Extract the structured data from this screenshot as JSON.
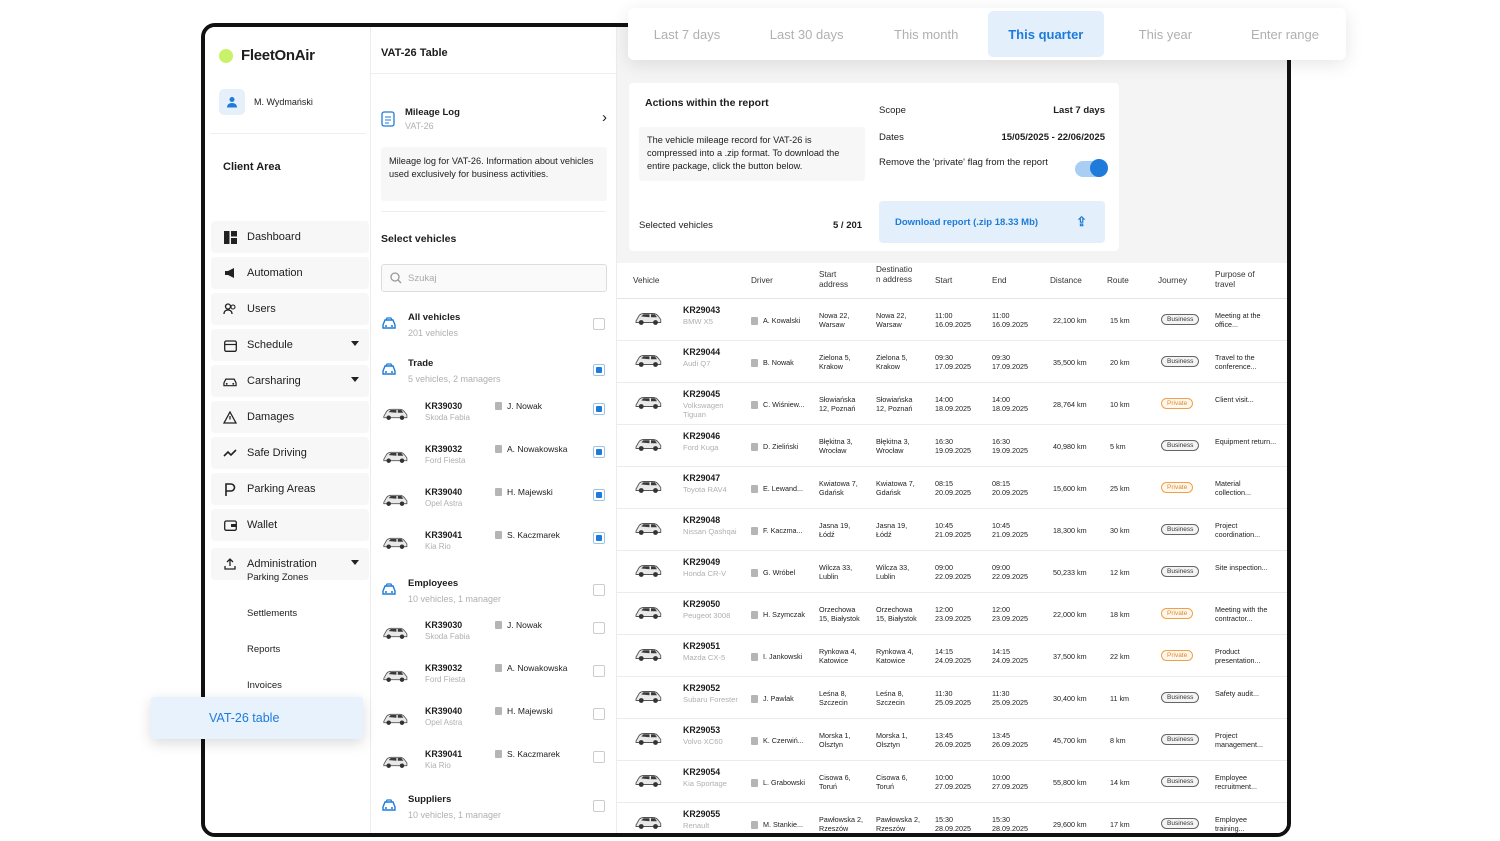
{
  "app": {
    "name": "FleetOnAir",
    "user": "M. Wydmański",
    "client_area": "Client Area"
  },
  "nav": [
    {
      "label": "Dashboard",
      "icon": "dashboard-icon"
    },
    {
      "label": "Automation",
      "icon": "megaphone-icon"
    },
    {
      "label": "Users",
      "icon": "users-icon"
    },
    {
      "label": "Schedule",
      "icon": "calendar-icon",
      "expandable": true
    },
    {
      "label": "Carsharing",
      "icon": "car-icon",
      "expandable": true
    },
    {
      "label": "Damages",
      "icon": "warning-icon"
    },
    {
      "label": "Safe Driving",
      "icon": "trend-icon"
    },
    {
      "label": "Parking Areas",
      "icon": "parking-icon"
    },
    {
      "label": "Wallet",
      "icon": "wallet-icon"
    },
    {
      "label": "Administration",
      "icon": "upload-icon",
      "expandable": true
    }
  ],
  "admin_sub": [
    "Parking Zones",
    "Settlements",
    "Reports",
    "Invoices"
  ],
  "active_item": "VAT-26 table",
  "panel": {
    "title": "VAT-26 Table",
    "mileage_title": "Mileage Log",
    "mileage_sub": "VAT-26",
    "description": "Mileage log for VAT-26. Information about vehicles used exclusively for business activities.",
    "select_title": "Select vehicles",
    "search_placeholder": "Szukaj",
    "all": {
      "title": "All vehicles",
      "sub": "201 vehicles"
    },
    "groups": [
      {
        "title": "Trade",
        "sub": "5 vehicles, 2 managers",
        "checked": true,
        "vehicles": [
          {
            "plate": "KR39030",
            "model": "Skoda Fabia",
            "driver": "J. Nowak",
            "checked": true
          },
          {
            "plate": "KR39032",
            "model": "Ford Fiesta",
            "driver": "A. Nowakowska",
            "checked": true
          },
          {
            "plate": "KR39040",
            "model": "Opel Astra",
            "driver": "H. Majewski",
            "checked": true
          },
          {
            "plate": "KR39041",
            "model": "Kia Rio",
            "driver": "S. Kaczmarek",
            "checked": true
          }
        ]
      },
      {
        "title": "Employees",
        "sub": "10 vehicles, 1 manager",
        "checked": false,
        "vehicles": [
          {
            "plate": "KR39030",
            "model": "Skoda Fabia",
            "driver": "J. Nowak",
            "checked": false
          },
          {
            "plate": "KR39032",
            "model": "Ford Fiesta",
            "driver": "A. Nowakowska",
            "checked": false
          },
          {
            "plate": "KR39040",
            "model": "Opel Astra",
            "driver": "H. Majewski",
            "checked": false
          },
          {
            "plate": "KR39041",
            "model": "Kia Rio",
            "driver": "S. Kaczmarek",
            "checked": false
          }
        ]
      },
      {
        "title": "Suppliers",
        "sub": "10 vehicles, 1 manager",
        "checked": false,
        "vehicles": []
      }
    ]
  },
  "ranges": [
    "Last 7 days",
    "Last 30 days",
    "This month",
    "This quarter",
    "This year",
    "Enter range"
  ],
  "active_range": "This quarter",
  "actions": {
    "title": "Actions within the report",
    "info": "The vehicle mileage record for VAT-26 is compressed into a .zip format. To download the entire package, click the button below.",
    "selected_label": "Selected vehicles",
    "selected_value": "5 / 201",
    "scope_label": "Scope",
    "scope_value": "Last 7 days",
    "dates_label": "Dates",
    "dates_value": "15/05/2025 - 22/06/2025",
    "private_label": "Remove the 'private' flag from the report",
    "private_on": true,
    "download": "Download report (.zip 18.33 Mb)"
  },
  "table": {
    "headers": [
      "Vehicle",
      "Driver",
      "Start address",
      "Destination address",
      "Start",
      "End",
      "Distance",
      "Route",
      "Journey",
      "Purpose of travel"
    ],
    "rows": [
      {
        "plate": "KR29043",
        "model": "BMW X5",
        "driver": "A. Kowalski",
        "start_addr": "Nowa 22, Warsaw",
        "dest_addr": "Nowa 22, Warsaw",
        "start_t": "11:00",
        "start_d": "16.09.2025",
        "end_t": "11:00",
        "end_d": "16.09.2025",
        "distance": "22,100 km",
        "route": "15 km",
        "journey": "Business",
        "purpose": "Meeting at the office..."
      },
      {
        "plate": "KR29044",
        "model": "Audi Q7",
        "driver": "B. Nowak",
        "start_addr": "Zielona 5, Krakow",
        "dest_addr": "Zielona 5, Krakow",
        "start_t": "09:30",
        "start_d": "17.09.2025",
        "end_t": "09:30",
        "end_d": "17.09.2025",
        "distance": "35,500 km",
        "route": "20 km",
        "journey": "Business",
        "purpose": "Travel to the conference..."
      },
      {
        "plate": "KR29045",
        "model": "Volkswagen Tiguan",
        "driver": "C. Wiśniew...",
        "start_addr": "Słowiańska 12, Poznań",
        "dest_addr": "Słowiańska 12, Poznań",
        "start_t": "14:00",
        "start_d": "18.09.2025",
        "end_t": "14:00",
        "end_d": "18.09.2025",
        "distance": "28,764 km",
        "route": "10 km",
        "journey": "Private",
        "purpose": "Client visit..."
      },
      {
        "plate": "KR29046",
        "model": "Ford Kuga",
        "driver": "D. Zieliński",
        "start_addr": "Błękitna 3, Wrocław",
        "dest_addr": "Błękitna 3, Wrocław",
        "start_t": "16:30",
        "start_d": "19.09.2025",
        "end_t": "16:30",
        "end_d": "19.09.2025",
        "distance": "40,980 km",
        "route": "5 km",
        "journey": "Business",
        "purpose": "Equipment return..."
      },
      {
        "plate": "KR29047",
        "model": "Toyota RAV4",
        "driver": "E. Lewand...",
        "start_addr": "Kwiatowa 7, Gdańsk",
        "dest_addr": "Kwiatowa 7, Gdańsk",
        "start_t": "08:15",
        "start_d": "20.09.2025",
        "end_t": "08:15",
        "end_d": "20.09.2025",
        "distance": "15,600 km",
        "route": "25 km",
        "journey": "Private",
        "purpose": "Material collection..."
      },
      {
        "plate": "KR29048",
        "model": "Nissan Qashqai",
        "driver": "F. Kaczma...",
        "start_addr": "Jasna 19, Łódź",
        "dest_addr": "Jasna 19, Łódź",
        "start_t": "10:45",
        "start_d": "21.09.2025",
        "end_t": "10:45",
        "end_d": "21.09.2025",
        "distance": "18,300 km",
        "route": "30 km",
        "journey": "Business",
        "purpose": "Project coordination..."
      },
      {
        "plate": "KR29049",
        "model": "Honda CR-V",
        "driver": "G. Wróbel",
        "start_addr": "Wilcza 33, Lublin",
        "dest_addr": "Wilcza 33, Lublin",
        "start_t": "09:00",
        "start_d": "22.09.2025",
        "end_t": "09:00",
        "end_d": "22.09.2025",
        "distance": "50,233 km",
        "route": "12 km",
        "journey": "Business",
        "purpose": "Site inspection..."
      },
      {
        "plate": "KR29050",
        "model": "Peugeot 3008",
        "driver": "H. Szymczak",
        "start_addr": "Orzechowa 15, Białystok",
        "dest_addr": "Orzechowa 15, Białystok",
        "start_t": "12:00",
        "start_d": "23.09.2025",
        "end_t": "12:00",
        "end_d": "23.09.2025",
        "distance": "22,000 km",
        "route": "18 km",
        "journey": "Private",
        "purpose": "Meeting with the contractor..."
      },
      {
        "plate": "KR29051",
        "model": "Mazda CX-5",
        "driver": "I. Jankowski",
        "start_addr": "Rynkowa 4, Katowice",
        "dest_addr": "Rynkowa 4, Katowice",
        "start_t": "14:15",
        "start_d": "24.09.2025",
        "end_t": "14:15",
        "end_d": "24.09.2025",
        "distance": "37,500 km",
        "route": "22 km",
        "journey": "Private",
        "purpose": "Product presentation..."
      },
      {
        "plate": "KR29052",
        "model": "Subaru Forester",
        "driver": "J. Pawlak",
        "start_addr": "Leśna 8, Szczecin",
        "dest_addr": "Leśna 8, Szczecin",
        "start_t": "11:30",
        "start_d": "25.09.2025",
        "end_t": "11:30",
        "end_d": "25.09.2025",
        "distance": "30,400 km",
        "route": "11 km",
        "journey": "Business",
        "purpose": "Safety audit..."
      },
      {
        "plate": "KR29053",
        "model": "Volvo XC60",
        "driver": "K. Czerwiń...",
        "start_addr": "Morska 1, Olsztyn",
        "dest_addr": "Morska 1, Olsztyn",
        "start_t": "13:45",
        "start_d": "26.09.2025",
        "end_t": "13:45",
        "end_d": "26.09.2025",
        "distance": "45,700 km",
        "route": "8 km",
        "journey": "Business",
        "purpose": "Project management..."
      },
      {
        "plate": "KR29054",
        "model": "Kia Sportage",
        "driver": "L. Grabowski",
        "start_addr": "Cisowa 6, Toruń",
        "dest_addr": "Cisowa 6, Toruń",
        "start_t": "10:00",
        "start_d": "27.09.2025",
        "end_t": "10:00",
        "end_d": "27.09.2025",
        "distance": "55,800 km",
        "route": "14 km",
        "journey": "Business",
        "purpose": "Employee recruitment..."
      },
      {
        "plate": "KR29055",
        "model": "Renault",
        "driver": "M. Stankie...",
        "start_addr": "Pawłowska 2, Rzeszów",
        "dest_addr": "Pawłowska 2, Rzeszów",
        "start_t": "15:30",
        "start_d": "28.09.2025",
        "end_t": "15:30",
        "end_d": "28.09.2025",
        "distance": "29,600 km",
        "route": "17 km",
        "journey": "Business",
        "purpose": "Employee training..."
      }
    ]
  },
  "colors": {
    "accent": "#1e7bd9",
    "accent_light": "#e3effb",
    "logo_dot": "#c9f26b",
    "private": "#e08a2e"
  }
}
